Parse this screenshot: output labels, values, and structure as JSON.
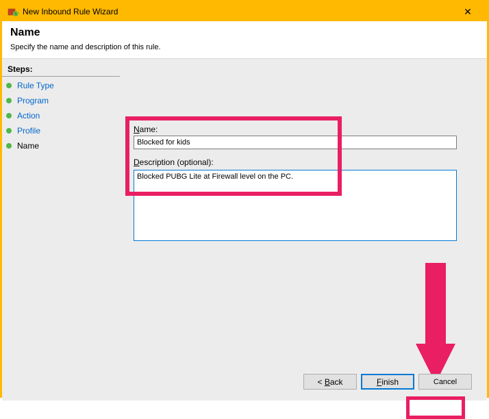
{
  "window": {
    "title": "New Inbound Rule Wizard",
    "close_glyph": "✕"
  },
  "header": {
    "title": "Name",
    "subtitle": "Specify the name and description of this rule."
  },
  "sidebar": {
    "steps_label": "Steps:",
    "items": [
      {
        "label": "Rule Type",
        "state": "done"
      },
      {
        "label": "Program",
        "state": "done"
      },
      {
        "label": "Action",
        "state": "done"
      },
      {
        "label": "Profile",
        "state": "done"
      },
      {
        "label": "Name",
        "state": "current"
      }
    ]
  },
  "form": {
    "name_label_u": "N",
    "name_label_rest": "ame:",
    "name_value": "Blocked for kids",
    "desc_label_u": "D",
    "desc_label_rest": "escription (optional):",
    "desc_value": "Blocked PUBG Lite at Firewall level on the PC."
  },
  "buttons": {
    "back_prefix": "< ",
    "back_u": "B",
    "back_rest": "ack",
    "finish_u": "F",
    "finish_rest": "inish",
    "cancel": "Cancel"
  },
  "annotations": {
    "highlight_color": "#e91e63"
  }
}
